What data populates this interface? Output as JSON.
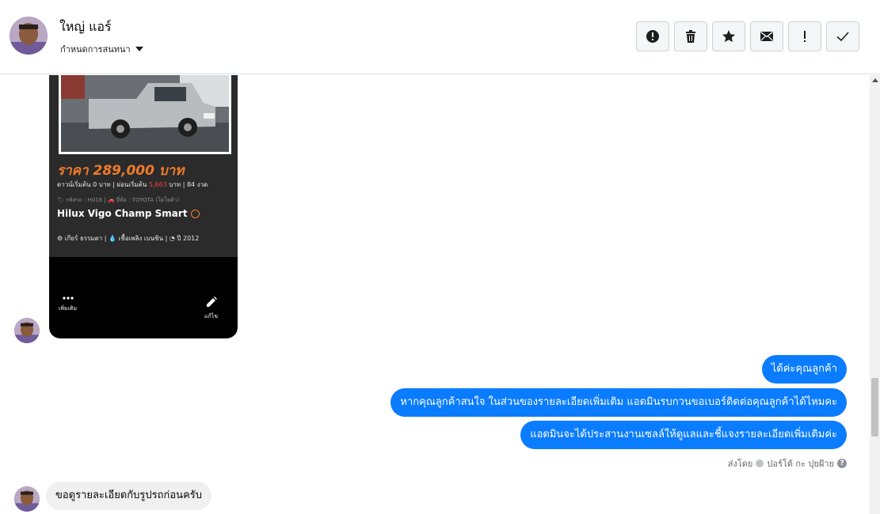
{
  "header": {
    "contact_name": "ใหญ่ แอร์",
    "conversation_settings": "กำหนดการสนทนา",
    "actions": [
      {
        "name": "spam-button",
        "icon": "alert-circle-icon"
      },
      {
        "name": "delete-button",
        "icon": "trash-icon"
      },
      {
        "name": "star-button",
        "icon": "star-icon"
      },
      {
        "name": "mark-unread-button",
        "icon": "envelope-icon"
      },
      {
        "name": "follow-up-button",
        "icon": "exclamation-icon"
      },
      {
        "name": "mark-done-button",
        "icon": "checkmark-icon"
      }
    ]
  },
  "attachment": {
    "price": "ราคา 289,000 บาท",
    "terms_prefix": "ดาวน์เริ่มต้น 0 บาท | ผ่อนเริ่มต้น ",
    "terms_highlight": "5,663",
    "terms_suffix": " บาท | 84 งวด",
    "code_line": "🏷 รหัสรถ : H016 | 🚗 ยี่ห้อ : TOYOTA (โตโยต้า)",
    "model": "Hilux Vigo Champ Smart",
    "specs": "⚙ เกียร์ ธรรมดา   |   💧 เชื้อเพลิง เบนซิน   |   ◔ ปี 2012",
    "more_label": "เพิ่มเติม",
    "edit_label": "แก้ไข"
  },
  "messages_out": [
    "ได้ค่ะคุณลูกค้า",
    "หากคุณลูกค้าสนใจ ในส่วนของรายละเอียดเพิ่มเติม แอดมินรบกวนขอเบอร์ติดต่อคุณลูกค้าได้ไหมคะ",
    "แอดมินจะได้ประสานงานเซลล์ให้ดูแลและชี้แจงรายละเอียดเพิ่มเติมค่ะ"
  ],
  "sent_by": {
    "prefix": "ส่งโดย",
    "name": "ปอร์โต้ กะ ปุยฝ้าย"
  },
  "message_in": "ขอดูรายละเอียดกับรูปรถก่อนครับ",
  "colors": {
    "outgoing_bubble": "#0a7cff",
    "incoming_bubble": "#f0f0f0",
    "price_orange": "#f07b2a"
  }
}
